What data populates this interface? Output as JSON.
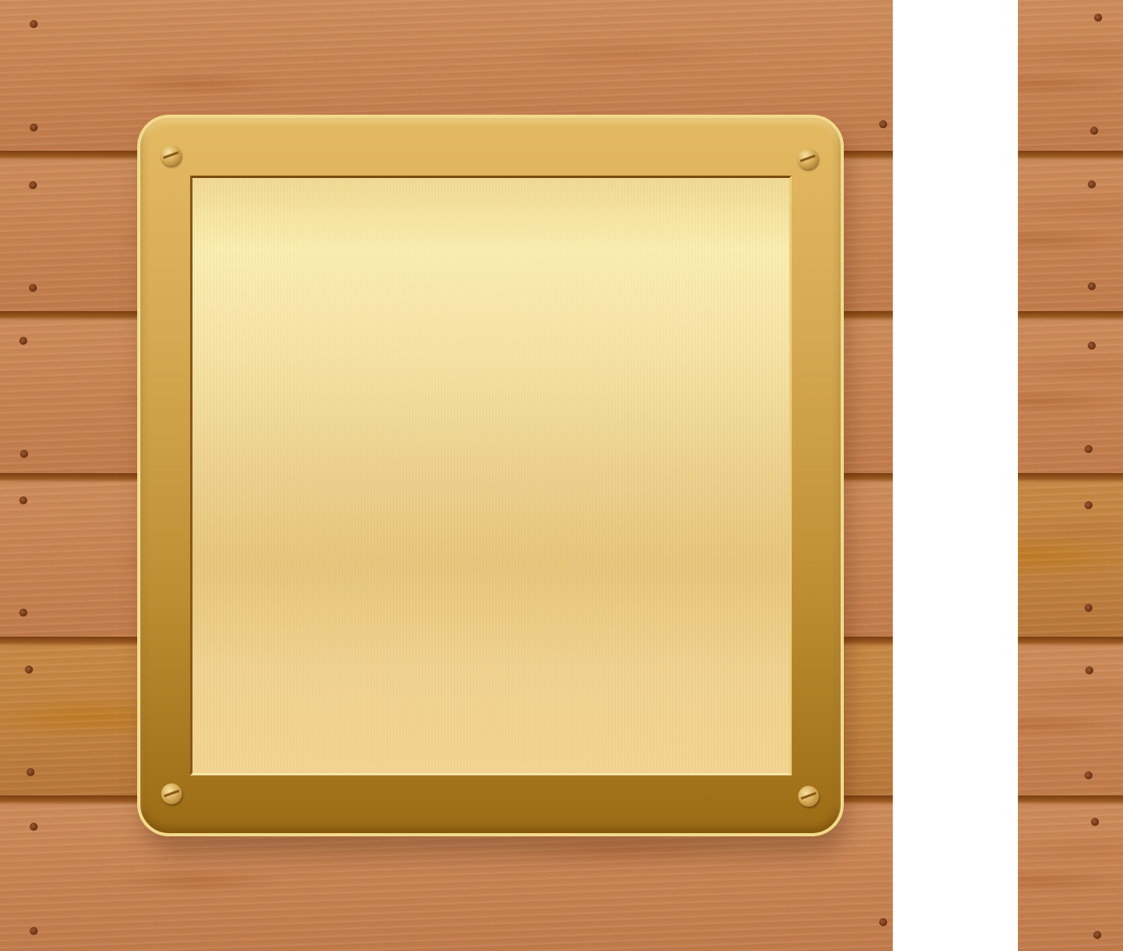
{
  "scene": {
    "description_tags": [
      "wood-planks",
      "brass-plaque",
      "screws"
    ],
    "colors": {
      "wood": "#c98453",
      "wood_seam": "#7a3f10",
      "brass_frame": "#d6aa52",
      "brass_face": "#f4dea0",
      "background": "#ffffff"
    },
    "plaque": {
      "text": ""
    }
  }
}
